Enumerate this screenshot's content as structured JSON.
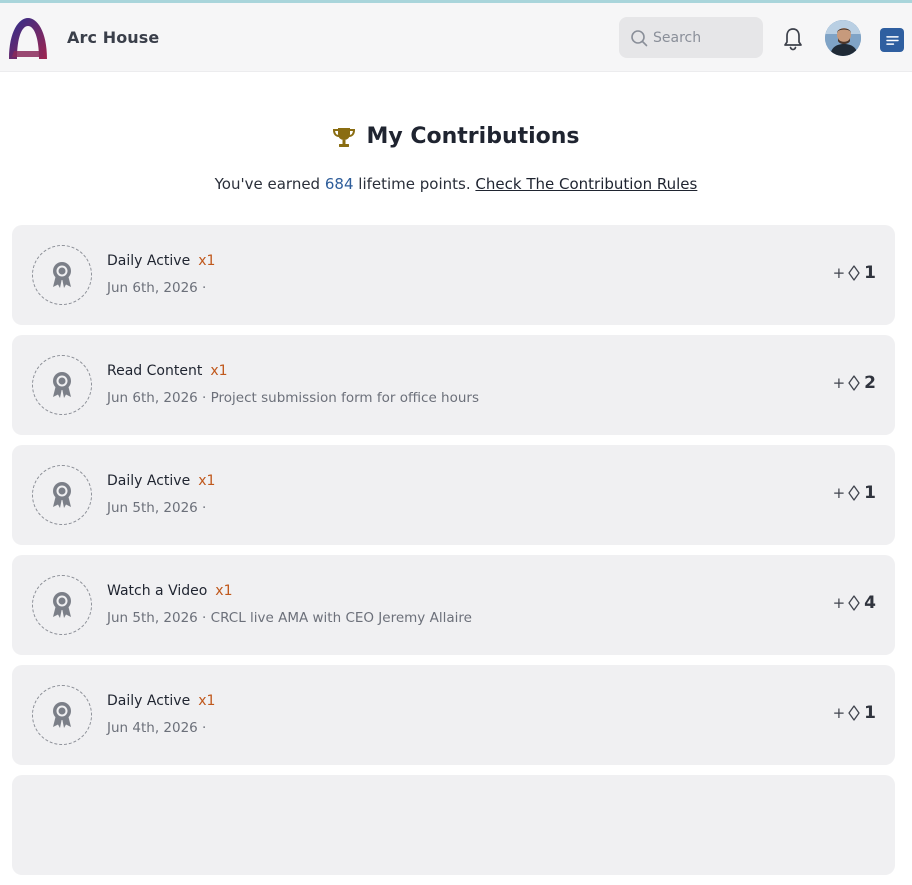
{
  "header": {
    "brand": "Arc House",
    "search_placeholder": "Search",
    "logo_icon": "arc-logo-icon",
    "notification_icon": "bell-icon",
    "menu_icon": "menu-icon"
  },
  "page": {
    "title": "My Contributions",
    "trophy_icon": "trophy-icon",
    "earned_prefix": "You've earned",
    "points": "684",
    "earned_suffix": "lifetime points.",
    "rules_link": "Check The Contribution Rules"
  },
  "contributions": [
    {
      "title": "Daily Active",
      "multiplier": "x1",
      "meta": "Jun 6th, 2026 ·",
      "plus": "+",
      "points": "1"
    },
    {
      "title": "Read Content",
      "multiplier": "x1",
      "meta": "Jun 6th, 2026 · Project submission form for office hours",
      "plus": "+",
      "points": "2"
    },
    {
      "title": "Daily Active",
      "multiplier": "x1",
      "meta": "Jun 5th, 2026 ·",
      "plus": "+",
      "points": "1"
    },
    {
      "title": "Watch a Video",
      "multiplier": "x1",
      "meta": "Jun 5th, 2026 · CRCL live AMA with CEO Jeremy Allaire",
      "plus": "+",
      "points": "4"
    },
    {
      "title": "Daily Active",
      "multiplier": "x1",
      "meta": "Jun 4th, 2026 ·",
      "plus": "+",
      "points": "1"
    }
  ],
  "colors": {
    "accent_blue": "#2e5d9a",
    "multiplier_orange": "#c0581c",
    "card_bg": "#f0f0f2",
    "trophy_gold": "#8a6d12"
  }
}
